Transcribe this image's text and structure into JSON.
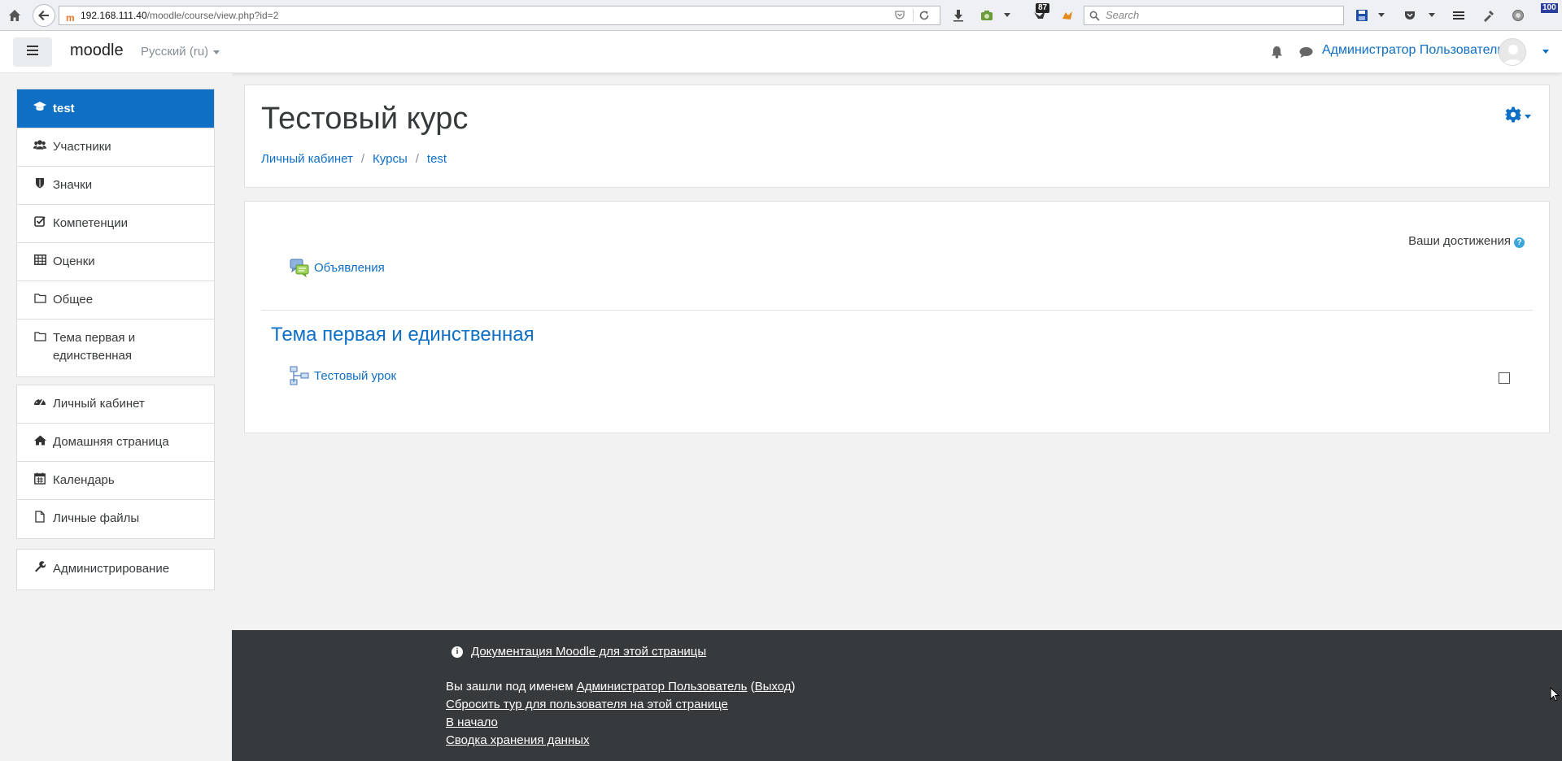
{
  "browser": {
    "url_host": "192.168.111.40",
    "url_path": "/moodle/course/view.php?id=2",
    "search_placeholder": "Search",
    "downloads_badge": "87",
    "zoom_badge": "100"
  },
  "navbar": {
    "brand": "moodle",
    "language": "Русский (ru)",
    "user_name": "Администратор Пользователь"
  },
  "drawer": {
    "course_items": [
      {
        "label": "test",
        "icon": "graduation-cap-icon",
        "active": true
      },
      {
        "label": "Участники",
        "icon": "users-icon"
      },
      {
        "label": "Значки",
        "icon": "shield-icon"
      },
      {
        "label": "Компетенции",
        "icon": "checkbox-icon"
      },
      {
        "label": "Оценки",
        "icon": "table-icon"
      },
      {
        "label": "Общее",
        "icon": "folder-icon"
      },
      {
        "label": "Тема первая и единственная",
        "icon": "folder-icon"
      }
    ],
    "site_items": [
      {
        "label": "Личный кабинет",
        "icon": "dashboard-icon"
      },
      {
        "label": "Домашняя страница",
        "icon": "home-icon"
      },
      {
        "label": "Календарь",
        "icon": "calendar-icon"
      },
      {
        "label": "Личные файлы",
        "icon": "file-icon"
      }
    ],
    "admin_items": [
      {
        "label": "Администрирование",
        "icon": "wrench-icon"
      }
    ]
  },
  "header": {
    "title": "Тестовый курс",
    "breadcrumb": [
      "Личный кабинет",
      "Курсы",
      "test"
    ]
  },
  "content": {
    "progress_label": "Ваши достижения",
    "general_activity": "Объявления",
    "section_title": "Тема первая и единственная",
    "section_activity": "Тестовый урок"
  },
  "footer": {
    "docs_link": "Документация Moodle для этой страницы",
    "logged_in_prefix": "Вы зашли под именем",
    "logged_in_user": "Администратор Пользователь",
    "logout_label": "Выход",
    "reset_tour": "Сбросить тур для пользователя на этой странице",
    "home": "В начало",
    "data_retention": "Сводка хранения данных"
  },
  "colors": {
    "accent": "#0f6fc5",
    "footer_bg": "#373a3c",
    "page_bg": "#f2f2f2"
  }
}
